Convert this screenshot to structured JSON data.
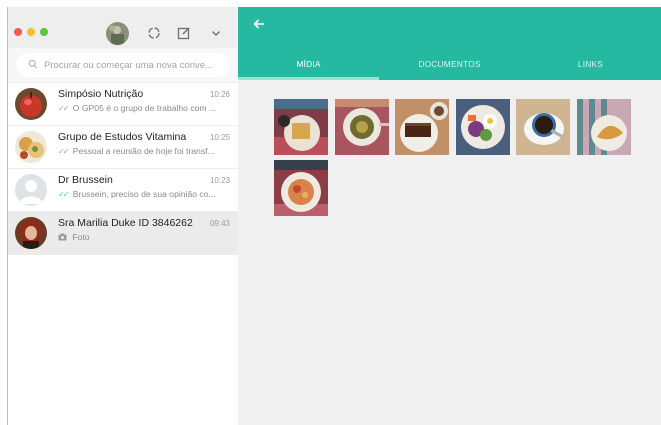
{
  "window": {
    "traffic_lights": [
      "close",
      "minimize",
      "zoom"
    ],
    "colors": {
      "close": "#ee5c54",
      "minimize": "#f7bc2c",
      "zoom": "#5fc33b"
    }
  },
  "sidebar": {
    "header_icons": [
      "status-icon",
      "new-chat-icon",
      "menu-chevron-icon"
    ],
    "search": {
      "placeholder": "Procurar ou começar uma nova conve...",
      "value": ""
    },
    "chats": [
      {
        "name": "Simpósio Nutrição",
        "time": "10:26",
        "preview": "O GP05 é o grupo de trabalho com ...",
        "tick": "grey"
      },
      {
        "name": "Grupo de Estudos Vitamina",
        "time": "10:25",
        "preview": "Pessoal a reunião de hoje foi transf...",
        "tick": "grey"
      },
      {
        "name": "Dr Brussein",
        "time": "10:23",
        "preview": "Brussein, preciso de sua opinião co...",
        "tick": "blue"
      },
      {
        "name": "Sra Marilia Duke ID 3846262",
        "time": "09:43",
        "preview": "Foto",
        "tick": "none"
      }
    ]
  },
  "main": {
    "accent_color": "#25b9a1",
    "tabs": [
      {
        "label": "MÍDIA",
        "active": true
      },
      {
        "label": "DOCUMENTOS",
        "active": false
      },
      {
        "label": "LINKS",
        "active": false
      }
    ],
    "media_thumbnails": [
      "toast-sandwich-photo",
      "soup-bowl-photo",
      "chocolate-cake-photo",
      "salad-plate-photo",
      "coffee-cup-photo",
      "croissant-photo",
      "pasta-plate-photo"
    ]
  }
}
